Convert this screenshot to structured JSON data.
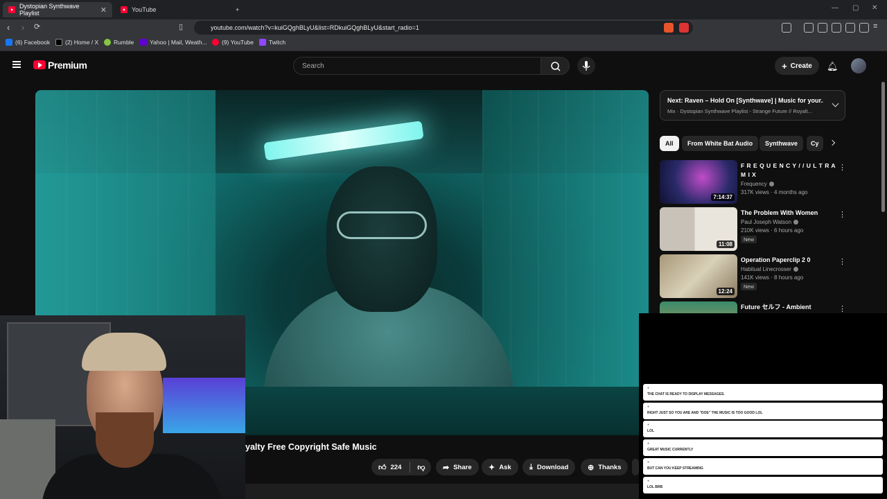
{
  "browser": {
    "tabs": [
      {
        "label": "Dystopian Synthwave Playlist",
        "active": true
      },
      {
        "label": "YouTube",
        "active": false
      }
    ],
    "new_tab": "+",
    "url": "youtube.com/watch?v=kuiGQghBLyU&list=RDkuiGQghBLyU&start_radio=1",
    "bookmarks": [
      {
        "label": "(6) Facebook",
        "color": "#1877f2"
      },
      {
        "label": "(2) Home / X",
        "color": "#000000"
      },
      {
        "label": "Rumble",
        "color": "#85c742"
      },
      {
        "label": "Yahoo | Mail, Weath...",
        "color": "#6001d2"
      },
      {
        "label": "(9) YouTube",
        "color": "#ff0033"
      },
      {
        "label": "Twitch",
        "color": "#9146ff"
      }
    ]
  },
  "header": {
    "brand": "Premium",
    "search_placeholder": "Search",
    "create_label": "Create"
  },
  "video": {
    "title": "yalty Free Copyright Safe Music",
    "likes": "224",
    "actions": {
      "share": "Share",
      "ask": "Ask",
      "download": "Download",
      "thanks": "Thanks"
    }
  },
  "next_up": {
    "title": "Next: Raven – Hold On [Synthwave] | Music for your...",
    "subtitle": "Mix · Dystopian Synthwave Playlist - Strange Future // Royalt..."
  },
  "chips": [
    "All",
    "From White Bat Audio",
    "Synthwave",
    "Cy"
  ],
  "recommendations": [
    {
      "title": "F R E Q U E N C Y / / U L T R A M I X",
      "channel": "Frequency",
      "meta": "317K views · 4 months ago",
      "duration": "7:14:37",
      "badge": ""
    },
    {
      "title": "The Problem With Women",
      "channel": "Paul Joseph Watson",
      "meta": "210K views · 6 hours ago",
      "duration": "11:08",
      "badge": "New"
    },
    {
      "title": "Operation Paperclip 2 0",
      "channel": "Habitual Linecrosser",
      "meta": "141K views · 8 hours ago",
      "duration": "12:24",
      "badge": "New"
    },
    {
      "title": "Future セルフ - Ambient",
      "channel": "",
      "meta": "",
      "duration": "",
      "badge": ""
    }
  ],
  "chat": [
    {
      "text": "THE CHAT IS READY TO DISPLAY MESSAGES."
    },
    {
      "text": "RIGHT JUST SO YOU ARE AND \"DOE\" THE MUSIC IS TOO GOOD LOL"
    },
    {
      "text": "LOL"
    },
    {
      "text": "GREAT MUSIC CURRENTLY"
    },
    {
      "text": "BUT CAN YOU KEEP STREAMING"
    },
    {
      "text": "LOL BRB"
    }
  ]
}
